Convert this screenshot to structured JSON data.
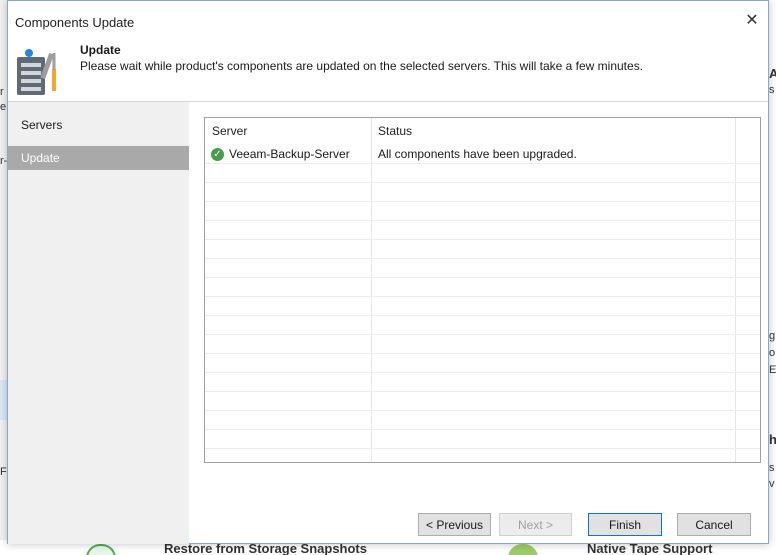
{
  "dialog": {
    "title": "Components Update",
    "close_glyph": "✕",
    "header": {
      "title": "Update",
      "description": "Please wait while product's components are updated on the selected servers. This will take a few minutes.",
      "icon": "server-tools-icon"
    },
    "sidebar": {
      "items": [
        {
          "label": "Servers",
          "active": false
        },
        {
          "label": "Update",
          "active": true
        }
      ]
    },
    "table": {
      "columns": [
        "Server",
        "Status"
      ],
      "rows": [
        {
          "server": "Veeam-Backup-Server",
          "status": "All components have been upgraded.",
          "icon": "check-circle-icon"
        }
      ]
    },
    "buttons": {
      "previous": "< Previous",
      "next": "Next >",
      "finish": "Finish",
      "cancel": "Cancel"
    }
  },
  "background": {
    "bottom_left_text": "Restore from Storage Snapshots",
    "bottom_right_text": "Native Tape Support",
    "right_fragments": [
      "A",
      "s",
      "g",
      "o",
      "E",
      "h",
      "s",
      "v"
    ],
    "left_fragments": [
      "r",
      "e",
      "r-",
      "F"
    ]
  },
  "colors": {
    "accent": "#0078d7",
    "sidebar_active": "#a9a9a9",
    "success": "#43a047"
  }
}
